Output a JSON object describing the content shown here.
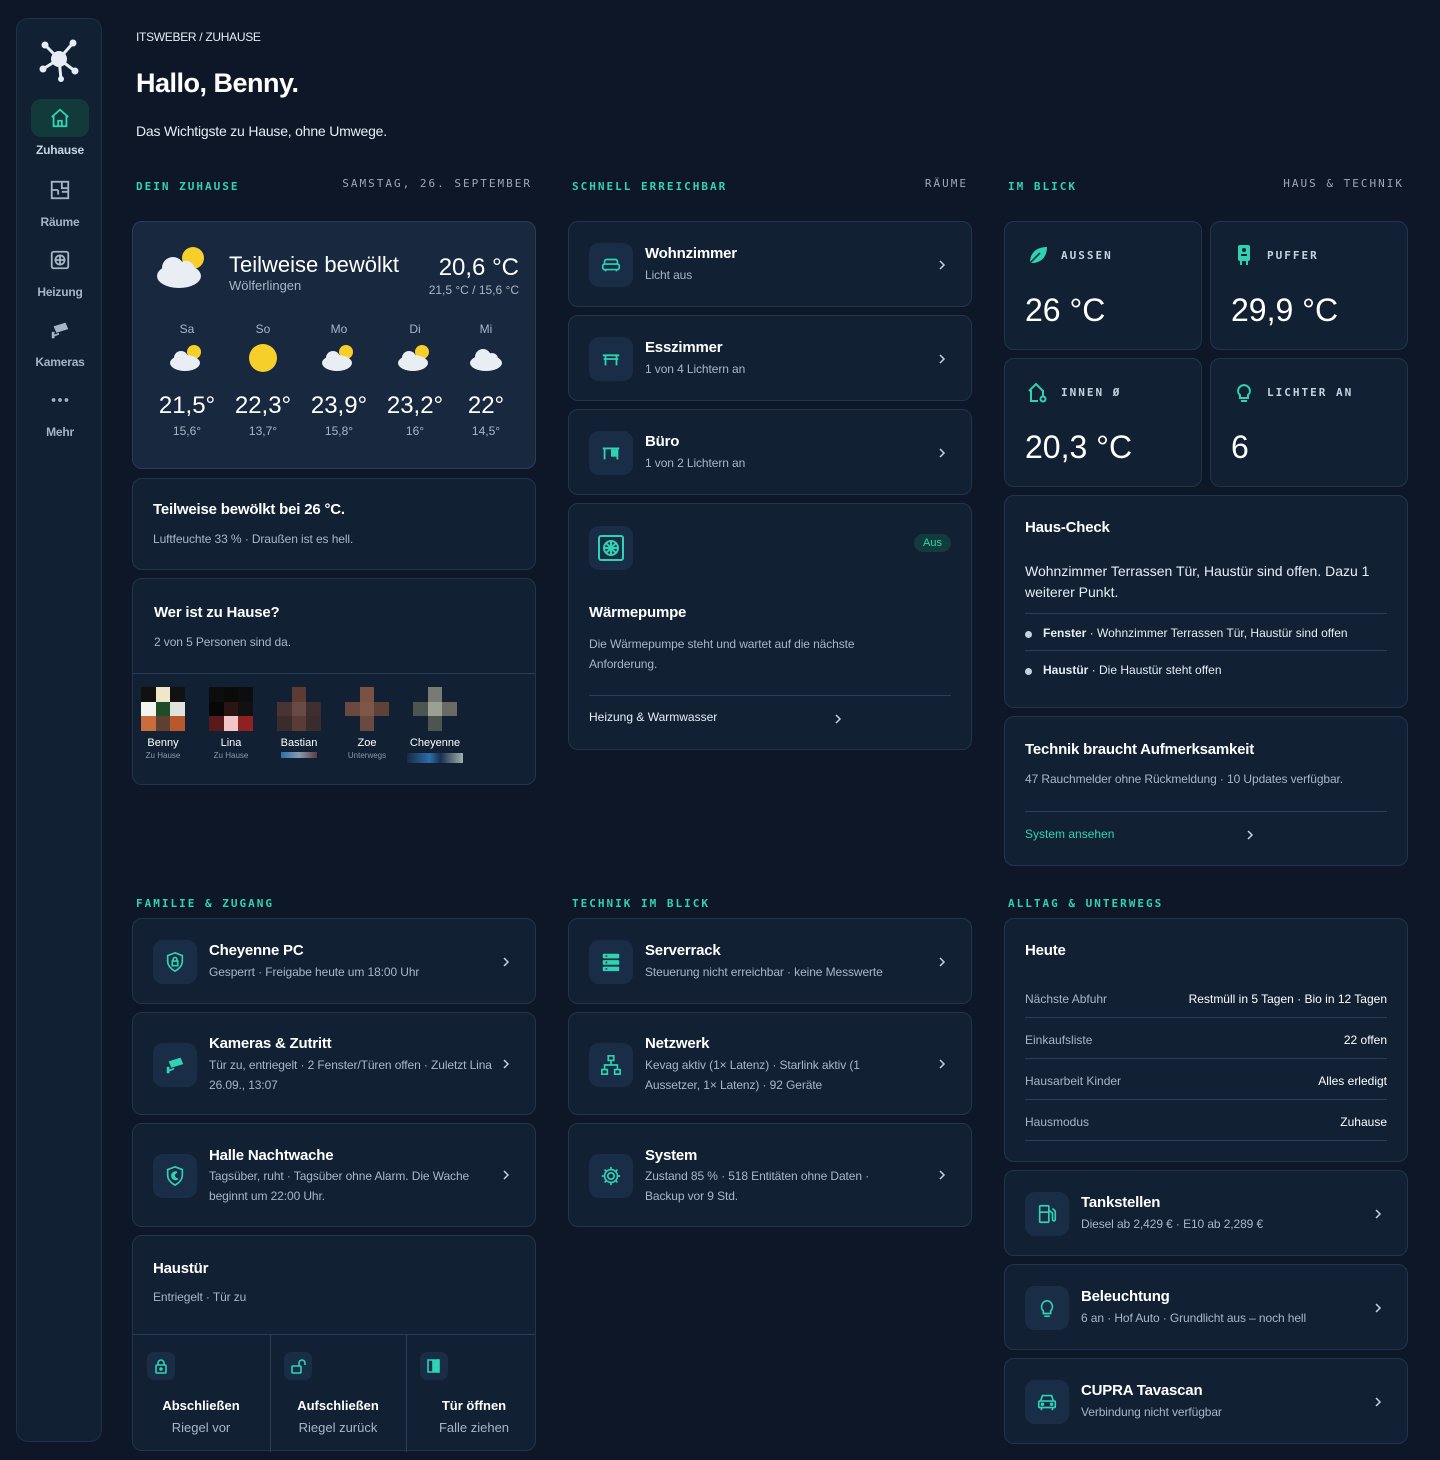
{
  "nav": [
    {
      "label": "Zuhause",
      "icon": "home-icon",
      "active": true
    },
    {
      "label": "Räume",
      "icon": "floorplan-icon"
    },
    {
      "label": "Heizung",
      "icon": "heating-icon"
    },
    {
      "label": "Kameras",
      "icon": "camera-icon"
    },
    {
      "label": "Mehr",
      "icon": "more-icon"
    }
  ],
  "header": {
    "breadcrumb": "ITSWEBER / ZUHAUSE",
    "title": "Hallo, Benny.",
    "subtitle": "Das Wichtigste zu Hause, ohne Umwege."
  },
  "sections": {
    "home": {
      "label": "DEIN ZUHAUSE",
      "right": "SAMSTAG, 26. SEPTEMBER"
    },
    "quick": {
      "label": "SCHNELL ERREICHBAR",
      "right": "RÄUME"
    },
    "glance": {
      "label": "IM BLICK",
      "right": "HAUS & TECHNIK"
    },
    "family": {
      "label": "FAMILIE & ZUGANG"
    },
    "tech": {
      "label": "TECHNIK IM BLICK"
    },
    "daily": {
      "label": "ALLTAG & UNTERWEGS"
    }
  },
  "weather": {
    "condition": "Teilweise bewölkt",
    "location": "Wölferlingen",
    "temp": "20,6 °C",
    "range": "21,5 °C / 15,6 °C",
    "forecast": [
      {
        "day": "Sa",
        "icon": "partly-cloudy-icon",
        "hi": "21,5°",
        "lo": "15,6°"
      },
      {
        "day": "So",
        "icon": "sun-icon",
        "hi": "22,3°",
        "lo": "13,7°"
      },
      {
        "day": "Mo",
        "icon": "partly-cloudy-icon",
        "hi": "23,9°",
        "lo": "15,8°"
      },
      {
        "day": "Di",
        "icon": "partly-cloudy-icon",
        "hi": "23,2°",
        "lo": "16°"
      },
      {
        "day": "Mi",
        "icon": "cloud-icon",
        "hi": "22°",
        "lo": "14,5°"
      }
    ]
  },
  "summary": {
    "title": "Teilweise bewölkt bei 26 °C.",
    "text": "Luftfeuchte 33 % · Draußen ist es hell."
  },
  "presence": {
    "title": "Wer ist zu Hause?",
    "text": "2 von 5 Personen sind da.",
    "people": [
      {
        "name": "Benny",
        "status": "Zu Hause"
      },
      {
        "name": "Lina",
        "status": "Zu Hause"
      },
      {
        "name": "Bastian",
        "status": ""
      },
      {
        "name": "Zoe",
        "status": "Unterwegs"
      },
      {
        "name": "Cheyenne",
        "status": ""
      }
    ]
  },
  "rooms": [
    {
      "name": "Wohnzimmer",
      "status": "Licht aus",
      "icon": "sofa-icon"
    },
    {
      "name": "Esszimmer",
      "status": "1 von 4 Lichtern an",
      "icon": "table-icon"
    },
    {
      "name": "Büro",
      "status": "1 von 2 Lichtern an",
      "icon": "desk-icon"
    }
  ],
  "heatpump": {
    "badge": "Aus",
    "title": "Wärmepumpe",
    "text": "Die Wärmepumpe steht und wartet auf die nächste Anforderung.",
    "link": "Heizung & Warmwasser"
  },
  "stats": [
    {
      "label": "AUSSEN",
      "value": "26 °C",
      "icon": "leaf-icon"
    },
    {
      "label": "PUFFER",
      "value": "29,9 °C",
      "icon": "boiler-icon"
    },
    {
      "label": "INNEN Ø",
      "value": "20,3 °C",
      "icon": "house-thermo-icon"
    },
    {
      "label": "LICHTER AN",
      "value": "6",
      "icon": "bulb-icon"
    }
  ],
  "housecheck": {
    "title": "Haus-Check",
    "text": "Wohnzimmer Terrassen Tür, Haustür sind offen. Dazu 1 weiterer Punkt.",
    "items": [
      {
        "key": "Fenster",
        "text": " · Wohnzimmer Terrassen Tür, Haustür sind offen"
      },
      {
        "key": "Haustür",
        "text": " · Die Haustür steht offen"
      }
    ]
  },
  "tech_attention": {
    "title": "Technik braucht Aufmerksamkeit",
    "text": "47 Rauchmelder ohne Rückmeldung · 10 Updates verfügbar.",
    "link": "System ansehen"
  },
  "family": [
    {
      "title": "Cheyenne PC",
      "sub": "Gesperrt · Freigabe heute um 18:00 Uhr",
      "icon": "shield-lock-icon"
    },
    {
      "title": "Kameras & Zutritt",
      "sub": "Tür zu, entriegelt · 2 Fenster/Türen offen · Zuletzt Lina 26.09., 13:07",
      "icon": "cctv-icon"
    },
    {
      "title": "Halle Nachtwache",
      "sub": "Tagsüber, ruht · Tagsüber ohne Alarm. Die Wache beginnt um 22:00 Uhr.",
      "icon": "shield-moon-icon"
    }
  ],
  "door": {
    "title": "Haustür",
    "text": "Entriegelt · Tür zu",
    "actions": [
      {
        "title": "Abschließen",
        "sub": "Riegel vor",
        "icon": "lock-icon"
      },
      {
        "title": "Aufschließen",
        "sub": "Riegel zurück",
        "icon": "unlock-icon"
      },
      {
        "title": "Tür öffnen",
        "sub": "Falle ziehen",
        "icon": "door-open-icon"
      }
    ]
  },
  "tech": [
    {
      "title": "Serverrack",
      "sub": "Steuerung nicht erreichbar · keine Messwerte",
      "icon": "server-icon"
    },
    {
      "title": "Netzwerk",
      "sub": "Kevag aktiv (1× Latenz) · Starlink aktiv (1 Aussetzer, 1× Latenz) · 92 Geräte",
      "icon": "network-icon"
    },
    {
      "title": "System",
      "sub": "Zustand 85 % · 518 Entitäten ohne Daten · Backup vor 9 Std.",
      "icon": "gear-icon"
    }
  ],
  "today": {
    "title": "Heute",
    "rows": [
      {
        "k": "Nächste Abfuhr",
        "v": "Restmüll in 5 Tagen · Bio in 12 Tagen"
      },
      {
        "k": "Einkaufsliste",
        "v": "22 offen"
      },
      {
        "k": "Hausarbeit Kinder",
        "v": "Alles erledigt"
      },
      {
        "k": "Hausmodus",
        "v": "Zuhause"
      }
    ]
  },
  "daily": [
    {
      "title": "Tankstellen",
      "sub": "Diesel ab 2,429 € · E10 ab 2,289 €",
      "icon": "fuel-icon"
    },
    {
      "title": "Beleuchtung",
      "sub": "6 an · Hof Auto · Grundlicht aus – noch hell",
      "icon": "bulb-icon"
    },
    {
      "title": "CUPRA Tavascan",
      "sub": "Verbindung nicht verfügbar",
      "icon": "car-icon"
    }
  ],
  "colors": {
    "accent": "#2fd3b3",
    "background": "#0d1727",
    "card": "#112033"
  }
}
